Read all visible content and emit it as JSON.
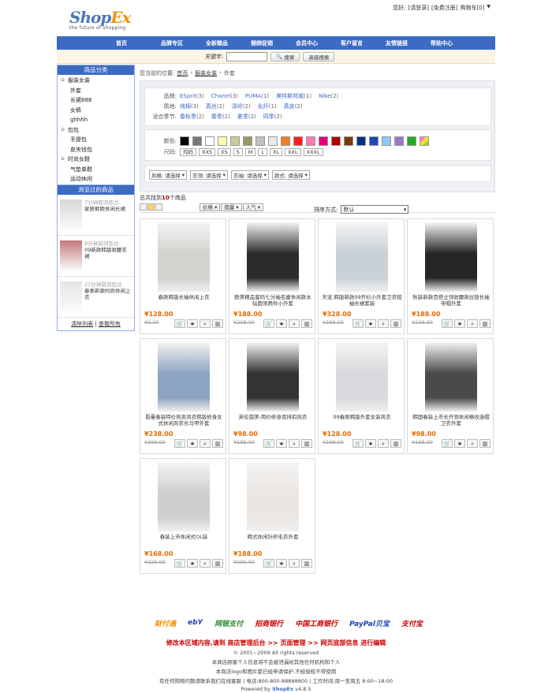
{
  "header": {
    "logo_main": "Shop",
    "logo_accent": "Ex",
    "logo_tagline": "the future of shopping",
    "greeting": "您好,",
    "login": "[请登录]",
    "register": "[免费注册]",
    "cart": "购物车[0]"
  },
  "nav": [
    "首页",
    "品牌专区",
    "全新赠品",
    "捆绑促销",
    "会员中心",
    "客户留言",
    "友情链接",
    "帮助中心"
  ],
  "search": {
    "label": "关键字:",
    "value": "",
    "button": "搜索",
    "advanced": "高级搜索"
  },
  "sidebar": {
    "category_title": "商品分类",
    "categories": [
      {
        "label": "服装女装",
        "level": 0,
        "toggle": "⊖"
      },
      {
        "label": "外套",
        "level": 1
      },
      {
        "label": "长裙888",
        "level": 1
      },
      {
        "label": "女裤",
        "level": 1
      },
      {
        "label": "ghhhh",
        "level": 1
      },
      {
        "label": "包包",
        "level": 0,
        "toggle": "⊖"
      },
      {
        "label": "手提包",
        "level": 1
      },
      {
        "label": "皮夹钱包",
        "level": 1
      },
      {
        "label": "时尚女鞋",
        "level": 0,
        "toggle": "⊖"
      },
      {
        "label": "气垫单鞋",
        "level": 1
      },
      {
        "label": "运动休闲",
        "level": 1
      }
    ],
    "history_title": "浏览过的商品",
    "history": [
      {
        "time": "7分钟前浏览过:",
        "name": "家居裤欧休闲长裙"
      },
      {
        "time": "9分钟前浏览过:",
        "name": "09新款韩版收腰衣裙"
      },
      {
        "time": "27分钟前浏览过:",
        "name": "春季新款时尚休闲上衣"
      }
    ],
    "clear": "清除列表",
    "view_all": "查看所有"
  },
  "breadcrumb": {
    "prefix": "您当前的位置:",
    "home": "首页",
    "cat": "服装女装",
    "current": "外套"
  },
  "filters": {
    "brand_label": "品牌:",
    "brands": [
      {
        "n": "ESprit",
        "c": "(3)"
      },
      {
        "n": "Chanel",
        "c": "(3)"
      },
      {
        "n": "PUMA",
        "c": "(1)"
      },
      {
        "n": "美特斯邦威",
        "c": "(1)"
      },
      {
        "n": "Nike",
        "c": "(2)"
      }
    ],
    "material_label": "质地:",
    "materials": [
      {
        "n": "纯棉",
        "c": "(3)"
      },
      {
        "n": "真丝",
        "c": "(2)"
      },
      {
        "n": "涤纶",
        "c": "(2)"
      },
      {
        "n": "化纤",
        "c": "(1)"
      },
      {
        "n": "真皮",
        "c": "(2)"
      }
    ],
    "season_label": "适合季节:",
    "seasons": [
      {
        "n": "春秋季",
        "c": "(2)"
      },
      {
        "n": "春季",
        "c": "(2)"
      },
      {
        "n": "夏季",
        "c": "(2)"
      },
      {
        "n": "四季",
        "c": "(2)"
      }
    ],
    "color_label": "颜色:",
    "colors": [
      "#000000",
      "#777777",
      "#ffffff",
      "#fff9b0",
      "#cccc99",
      "#999966",
      "#c0c0c0",
      "#e8e8e8",
      "#f07d1e",
      "#ff1e1e",
      "#ff78b4",
      "#e40078",
      "#b40000",
      "#7a3a0e",
      "#0b2d8a",
      "#1e46b4",
      "#8ec8ff",
      "#9a78c8",
      "#22aa22",
      "#mixed"
    ],
    "size_label": "尺码:",
    "sizes": [
      "均码",
      "XXS",
      "XS",
      "S",
      "M",
      "L",
      "XL",
      "XXL",
      "XXXL"
    ],
    "selects": [
      {
        "label": "风格:",
        "value": "请选择"
      },
      {
        "label": "衣领:",
        "value": "请选择"
      },
      {
        "label": "衣袖:",
        "value": "请选择"
      },
      {
        "label": "款式:",
        "value": "请选择"
      }
    ]
  },
  "listing": {
    "count_prefix": "总共找到",
    "count": "10",
    "count_suffix": "个商品",
    "sort_buttons": [
      "价格",
      "销量",
      "人气"
    ],
    "sort_label": "排序方式:",
    "sort_value": "默认"
  },
  "products": [
    {
      "name": "春款韩版长袖休闲上衣",
      "price": "¥128.00",
      "market": "¥0.00",
      "tone": "#d4d2cf"
    },
    {
      "name": "欧美精品蜜码七分袖名媛休闲款水钻圆领两件小外套",
      "price": "¥188.00",
      "market": "¥238.00",
      "tone": "#2b2b2b"
    },
    {
      "name": "天宠.韩版新款09开衫小外套卫衣短袖长裙套装",
      "price": "¥328.00",
      "market": "¥388.00",
      "tone": "#c9d0d6"
    },
    {
      "name": "秋装新款百搭立领收腰款拉链长袖带帽外套",
      "price": "¥188.00",
      "market": "¥228.00",
      "tone": "#262626"
    },
    {
      "name": "唇曼春装特价热卖风衣韩版修身女式休闲风衣长马甲外套",
      "price": "¥238.00",
      "market": "¥299.00",
      "tone": "#8da3c2"
    },
    {
      "name": "英伦甜美-简约修身双排扣风衣",
      "price": "¥98.00",
      "market": "¥185.00",
      "tone": "#333333"
    },
    {
      "name": "09春款韩版外套女装风衣",
      "price": "¥128.00",
      "market": "¥198.00",
      "tone": "#d7d9dc"
    },
    {
      "name": "韩国春装上市长开领休闲格纹连帽卫衣外套",
      "price": "¥98.00",
      "market": "¥168.00",
      "tone": "#4a4a4a"
    },
    {
      "name": "春装上市休闲式OL装",
      "price": "¥168.00",
      "market": "¥225.00",
      "tone": "#cfcfcf"
    },
    {
      "name": "韩式休闲针织毛衣外套",
      "price": "¥188.00",
      "market": "¥295.00",
      "tone": "#ebe6e2"
    }
  ],
  "footer": {
    "payments": [
      "财付通",
      "ebY",
      "网银支付",
      "招商银行",
      "中国工商银行",
      "PayPal贝宝",
      "支付宝"
    ],
    "edit_note": "修改本区域内容,请到 商店管理后台 >> 页面管理 >> 网页底部信息 进行编辑",
    "copyright": "© 2001~2009 All rights reserved",
    "line2": "本商店顾客个人信息将不会被泄漏给其他任何机构和个人",
    "line3": "本商店logo和图片都已经申请保护,不经授权不得使用",
    "line4": "有任何购物问题请联系我们在线客服 | 电话:800-800-88888800 | 工作时间:周一至周五 8:00~18:00",
    "powered_prefix": "Powered by",
    "powered_brand": "ShopEx",
    "version": "v4.8.5"
  },
  "accent_color": "#3d6bc4",
  "price_color": "#e66a00"
}
